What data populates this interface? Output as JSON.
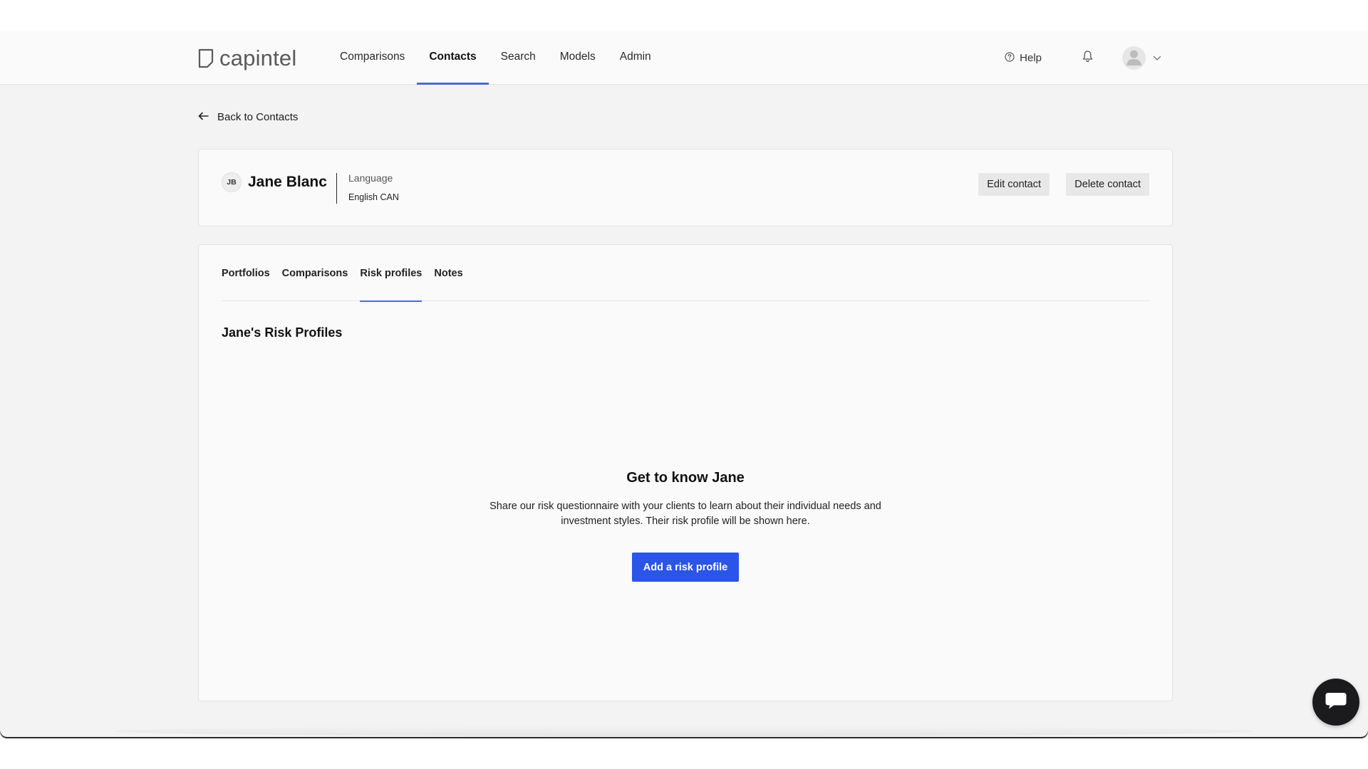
{
  "brand": {
    "name": "capintel",
    "logo_icon": "document-logo-icon"
  },
  "nav": {
    "items": [
      {
        "label": "Comparisons",
        "active": false
      },
      {
        "label": "Contacts",
        "active": true
      },
      {
        "label": "Search",
        "active": false
      },
      {
        "label": "Models",
        "active": false
      },
      {
        "label": "Admin",
        "active": false
      }
    ],
    "help_label": "Help",
    "accent_color": "#4a6bd6"
  },
  "back_link": {
    "label": "Back to Contacts"
  },
  "contact": {
    "initials": "JB",
    "name": "Jane Blanc",
    "language_label": "Language",
    "language_value": "English CAN",
    "edit_label": "Edit contact",
    "delete_label": "Delete contact"
  },
  "tabs": [
    {
      "label": "Portfolios",
      "active": false
    },
    {
      "label": "Comparisons",
      "active": false
    },
    {
      "label": "Risk profiles",
      "active": true
    },
    {
      "label": "Notes",
      "active": false
    }
  ],
  "risk_profiles": {
    "section_title": "Jane's Risk Profiles",
    "empty_title": "Get to know Jane",
    "empty_description": "Share our risk questionnaire with your clients to learn about their individual needs and investment styles. Their risk profile will be shown here.",
    "add_button_label": "Add a risk profile",
    "button_color": "#2a55e8"
  }
}
